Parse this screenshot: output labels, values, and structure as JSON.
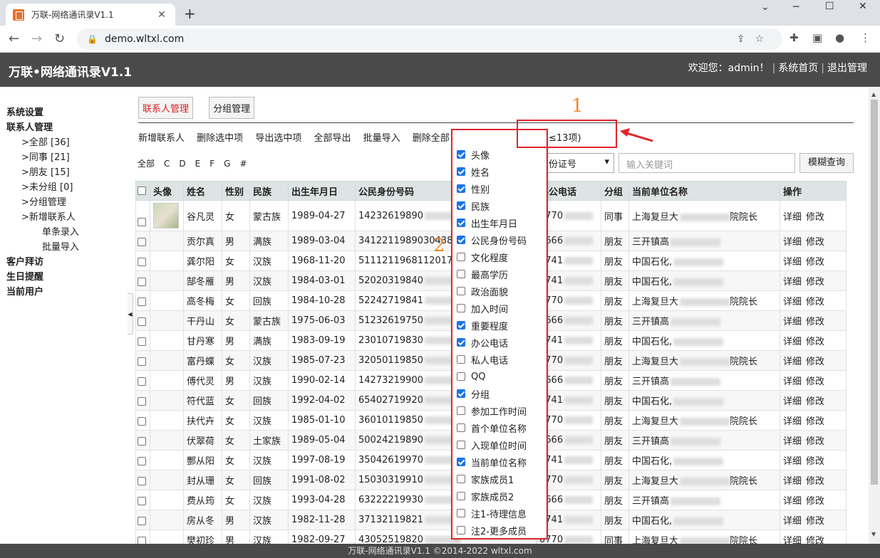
{
  "browser": {
    "tab_title": "万联-网络通讯录V1.1",
    "url": "demo.wltxl.com"
  },
  "app": {
    "title": "万联•网络通讯录V1.1",
    "welcome": "欢迎您：admin！",
    "home": "系统首页",
    "logout": "退出管理",
    "footer": "万联-网络通讯录V1.1 ©2014-2022 wltxl.com"
  },
  "sidebar": {
    "system_settings": "系统设置",
    "contact_mgmt": "联系人管理",
    "all": ">全部 [36]",
    "colleague": ">同事 [21]",
    "friend": ">朋友 [15]",
    "ungrouped": ">未分组 [0]",
    "group_mgmt": ">分组管理",
    "new_contact": ">新增联系人",
    "single_entry": "单条录入",
    "batch_import": "批量导入",
    "client_visit": "客户拜访",
    "birthday": "生日提醒",
    "current_user": "当前用户"
  },
  "main": {
    "tab_contacts": "联系人管理",
    "tab_groups": "分组管理",
    "toolbar": {
      "new": "新增联系人",
      "delete_selected": "删除选中项",
      "export_selected": "导出选中项",
      "export_all": "全部导出",
      "batch_import": "批量导入",
      "delete_all": "删除全部（慎用）",
      "display_settings": "显示项设置(≤13项)"
    },
    "letters": [
      "全部",
      "C",
      "D",
      "E",
      "F",
      "G",
      "#"
    ],
    "search_field": "身份证号",
    "search_placeholder": "输入关键词",
    "search_button": "模糊查询"
  },
  "table": {
    "headers": [
      "头像",
      "姓名",
      "性别",
      "民族",
      "出生年月日",
      "公民身份号码",
      "办公电话",
      "分组",
      "当前单位名称",
      "操作"
    ],
    "ops": [
      "详细",
      "修改"
    ],
    "rows": [
      {
        "name": "谷凡灵",
        "sex": "女",
        "nation": "蒙古族",
        "birth": "1989-04-27",
        "id": "14232619890",
        "phone": "0770",
        "group": "同事",
        "unit": "上海复旦大",
        "unit2": "院院长",
        "avatar": true
      },
      {
        "name": "贡尔真",
        "sex": "男",
        "nation": "满族",
        "birth": "1989-03-04",
        "id": "3412211989030438",
        "phone": "0666",
        "group": "朋友",
        "unit": "三开镇高"
      },
      {
        "name": "龚尔阳",
        "sex": "女",
        "nation": "汉族",
        "birth": "1968-11-20",
        "id": "5111211968112017",
        "phone": "3741",
        "group": "朋友",
        "unit": "中国石化,"
      },
      {
        "name": "郜冬雁",
        "sex": "男",
        "nation": "汉族",
        "birth": "1984-03-01",
        "id": "52020319840",
        "phone": "3741",
        "group": "朋友",
        "unit": "中国石化,"
      },
      {
        "name": "高冬梅",
        "sex": "女",
        "nation": "回族",
        "birth": "1984-10-28",
        "id": "52242719841",
        "phone": "0770",
        "group": "朋友",
        "unit": "上海复旦大",
        "unit2": "院院长"
      },
      {
        "name": "干丹山",
        "sex": "女",
        "nation": "蒙古族",
        "birth": "1975-06-03",
        "id": "51232619750",
        "phone": "0666",
        "group": "朋友",
        "unit": "三开镇高"
      },
      {
        "name": "甘丹寒",
        "sex": "男",
        "nation": "满族",
        "birth": "1983-09-19",
        "id": "23010719830",
        "phone": "3741",
        "group": "朋友",
        "unit": "中国石化,"
      },
      {
        "name": "富丹蝶",
        "sex": "女",
        "nation": "汉族",
        "birth": "1985-07-23",
        "id": "32050119850",
        "phone": "0770",
        "group": "朋友",
        "unit": "上海复旦大",
        "unit2": "院院长"
      },
      {
        "name": "傅代灵",
        "sex": "男",
        "nation": "汉族",
        "birth": "1990-02-14",
        "id": "14273219900",
        "phone": "0666",
        "group": "朋友",
        "unit": "三开镇高"
      },
      {
        "name": "符代蓝",
        "sex": "女",
        "nation": "回族",
        "birth": "1992-04-02",
        "id": "65402719920",
        "phone": "3741",
        "group": "朋友",
        "unit": "中国石化,"
      },
      {
        "name": "扶代卉",
        "sex": "女",
        "nation": "汉族",
        "birth": "1985-01-10",
        "id": "36010119850",
        "phone": "0770",
        "group": "朋友",
        "unit": "上海复旦大",
        "unit2": "院院长"
      },
      {
        "name": "伏翠荷",
        "sex": "女",
        "nation": "土家族",
        "birth": "1989-05-04",
        "id": "50024219890",
        "phone": "0666",
        "group": "朋友",
        "unit": "三开镇高"
      },
      {
        "name": "酆从阳",
        "sex": "女",
        "nation": "汉族",
        "birth": "1997-08-19",
        "id": "35042619970",
        "phone": "3741",
        "group": "朋友",
        "unit": "中国石化,"
      },
      {
        "name": "封从珊",
        "sex": "女",
        "nation": "回族",
        "birth": "1991-08-02",
        "id": "15030319910",
        "phone": "0770",
        "group": "朋友",
        "unit": "上海复旦大",
        "unit2": "院院长"
      },
      {
        "name": "费从筠",
        "sex": "女",
        "nation": "汉族",
        "birth": "1993-04-28",
        "id": "63222219930",
        "phone": "0666",
        "group": "朋友",
        "unit": "三开镇高"
      },
      {
        "name": "房从冬",
        "sex": "男",
        "nation": "汉族",
        "birth": "1982-11-28",
        "id": "37132119821",
        "phone": "3741",
        "group": "朋友",
        "unit": "中国石化,"
      },
      {
        "name": "樊初珍",
        "sex": "男",
        "nation": "汉族",
        "birth": "1982-09-27",
        "id": "43052519820",
        "phone": "0770",
        "group": "同事",
        "unit": "上海复旦大",
        "unit2": "院院长"
      }
    ]
  },
  "columns_menu": [
    {
      "label": "头像",
      "checked": true
    },
    {
      "label": "姓名",
      "checked": true
    },
    {
      "label": "性别",
      "checked": true
    },
    {
      "label": "民族",
      "checked": true
    },
    {
      "label": "出生年月日",
      "checked": true
    },
    {
      "label": "公民身份号码",
      "checked": true
    },
    {
      "label": "文化程度",
      "checked": false
    },
    {
      "label": "最高学历",
      "checked": false
    },
    {
      "label": "政治面貌",
      "checked": false
    },
    {
      "label": "加入时间",
      "checked": false
    },
    {
      "label": "重要程度",
      "checked": true
    },
    {
      "label": "办公电话",
      "checked": true
    },
    {
      "label": "私人电话",
      "checked": false
    },
    {
      "label": "QQ",
      "checked": false
    },
    {
      "label": "分组",
      "checked": true
    },
    {
      "label": "参加工作时间",
      "checked": false
    },
    {
      "label": "首个单位名称",
      "checked": false
    },
    {
      "label": "入现单位时间",
      "checked": false
    },
    {
      "label": "当前单位名称",
      "checked": true
    },
    {
      "label": "家族成员1",
      "checked": false
    },
    {
      "label": "家族成员2",
      "checked": false
    },
    {
      "label": "注1-待理信息",
      "checked": false
    },
    {
      "label": "注2-更多成员",
      "checked": false
    }
  ],
  "annotations": {
    "num1": "1",
    "num2": "2",
    "color": "#e0252a"
  }
}
